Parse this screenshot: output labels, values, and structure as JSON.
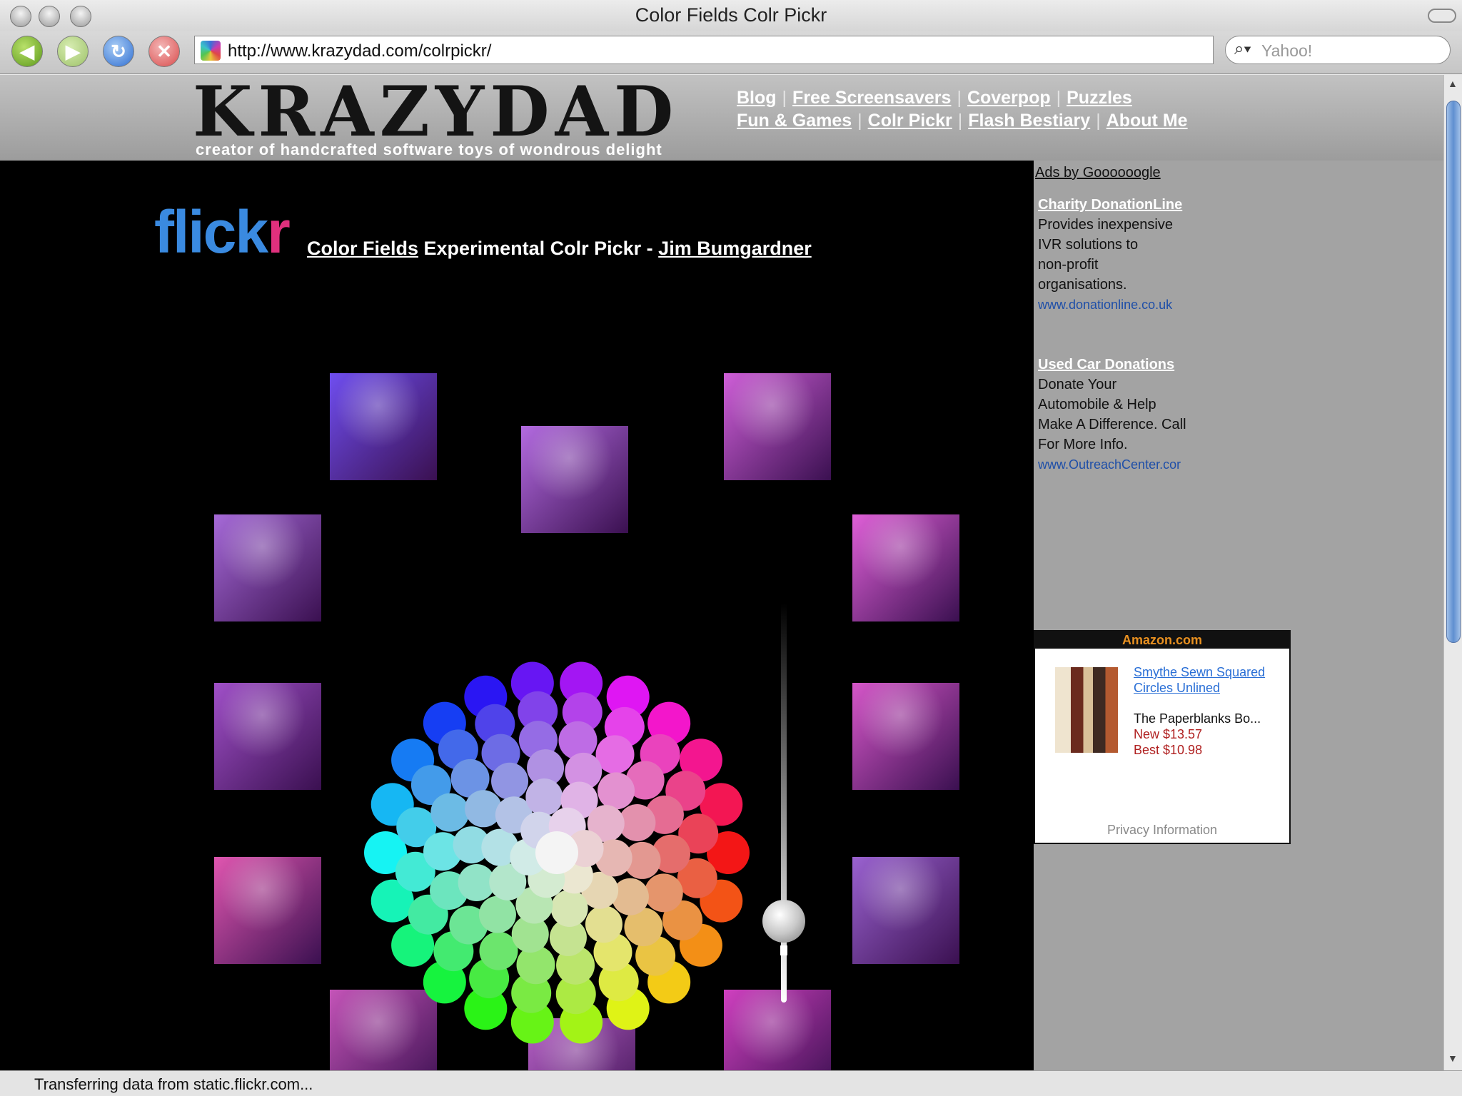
{
  "window": {
    "title": "Color Fields Colr Pickr"
  },
  "toolbar": {
    "url": "http://www.krazydad.com/colrpickr/",
    "search_placeholder": "Yahoo!"
  },
  "header": {
    "logo": "KRAZYDAD",
    "tagline": "creator of handcrafted software toys of wondrous delight",
    "nav": {
      "blog": "Blog",
      "screensavers": "Free Screensavers",
      "coverpop": "Coverpop",
      "puzzles": "Puzzles",
      "fun_games": "Fun & Games",
      "colr_pickr": "Colr Pickr",
      "flash_bestiary": "Flash Bestiary",
      "about_me": "About Me",
      "separator": "|"
    }
  },
  "app": {
    "flickr_part1": "flick",
    "flickr_part2": "r",
    "color_fields_link": "Color Fields",
    "title_middle": "Experimental Colr Pickr -",
    "author_link": "Jim Bumgardner",
    "thumb_colors": [
      "#6f4ef0",
      "#b36be0",
      "#cf5fd8",
      "#a66ad8",
      "#e060d8",
      "#a050c8",
      "#d657c9",
      "#e056b0",
      "#9a62d0",
      "#c454b8",
      "#b862c8",
      "#d040c0"
    ]
  },
  "ads": {
    "ads_by": "Ads by Goooooogle",
    "ad1": {
      "title": "Charity DonationLine",
      "line1": "Provides inexpensive",
      "line2": "IVR solutions to",
      "line3": "non-profit",
      "line4": "organisations.",
      "url": "www.donationline.co.uk"
    },
    "ad2": {
      "title": "Used Car Donations",
      "line1": "Donate Your",
      "line2": "Automobile & Help",
      "line3": "Make A Difference. Call",
      "line4": "For More Info.",
      "url": "www.OutreachCenter.cor"
    },
    "amazon": {
      "header": "Amazon.com",
      "product_link": "Smythe Sewn Squared Circles Unlined",
      "desc": "The Paperblanks Bo...",
      "new_price": "New $13.57",
      "best_price": "Best $10.98",
      "privacy": "Privacy Information"
    }
  },
  "status": {
    "text": "Transferring data from static.flickr.com..."
  }
}
